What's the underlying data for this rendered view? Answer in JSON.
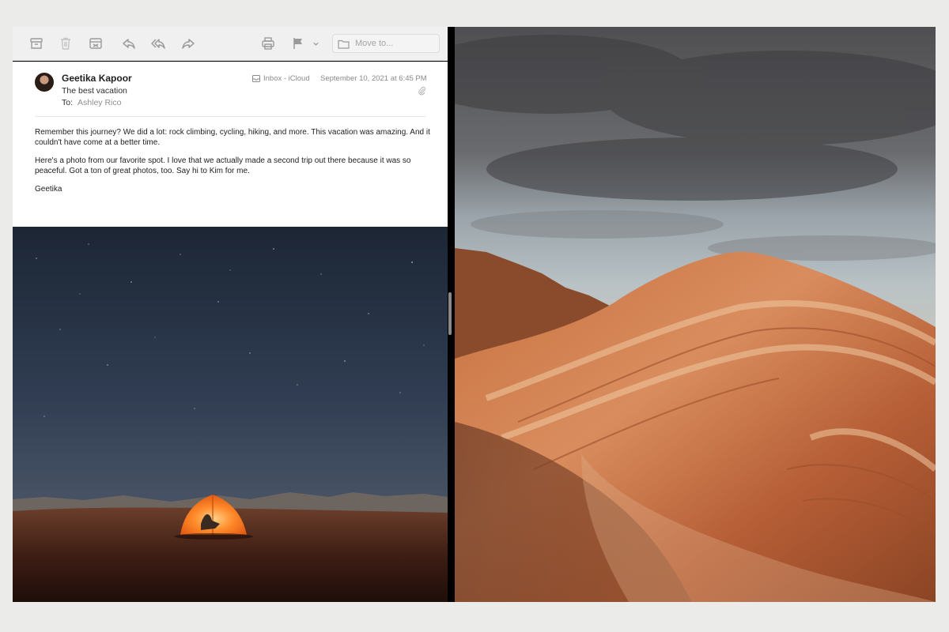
{
  "toolbar": {
    "buttons": [
      {
        "name": "archive-icon"
      },
      {
        "name": "trash-icon"
      },
      {
        "name": "junk-icon"
      },
      {
        "name": "reply-icon"
      },
      {
        "name": "reply-all-icon"
      },
      {
        "name": "forward-icon"
      },
      {
        "name": "print-icon"
      },
      {
        "name": "flag-icon"
      },
      {
        "name": "chevron-down-icon"
      }
    ],
    "move_to_placeholder": "Move to..."
  },
  "message": {
    "sender": "Geetika Kapoor",
    "subject": "The best vacation",
    "to_label": "To:",
    "to_name": "Ashley Rico",
    "mailbox": "Inbox - iCloud",
    "date": "September 10, 2021 at 6:45 PM",
    "body": [
      "Remember this journey? We did a lot: rock climbing, cycling, hiking, and more. This vacation was amazing. And it couldn't have come at a better time.",
      "Here's a photo from our favorite spot. I love that we actually made a second trip out there because it was so peaceful. Got a ton of great photos, too. Say hi to Kim for me.",
      "Geetika"
    ]
  },
  "colors": {
    "background": "#ebecea",
    "toolbar": "#f0f0f0",
    "icon_gray": "#9a9a9a"
  }
}
